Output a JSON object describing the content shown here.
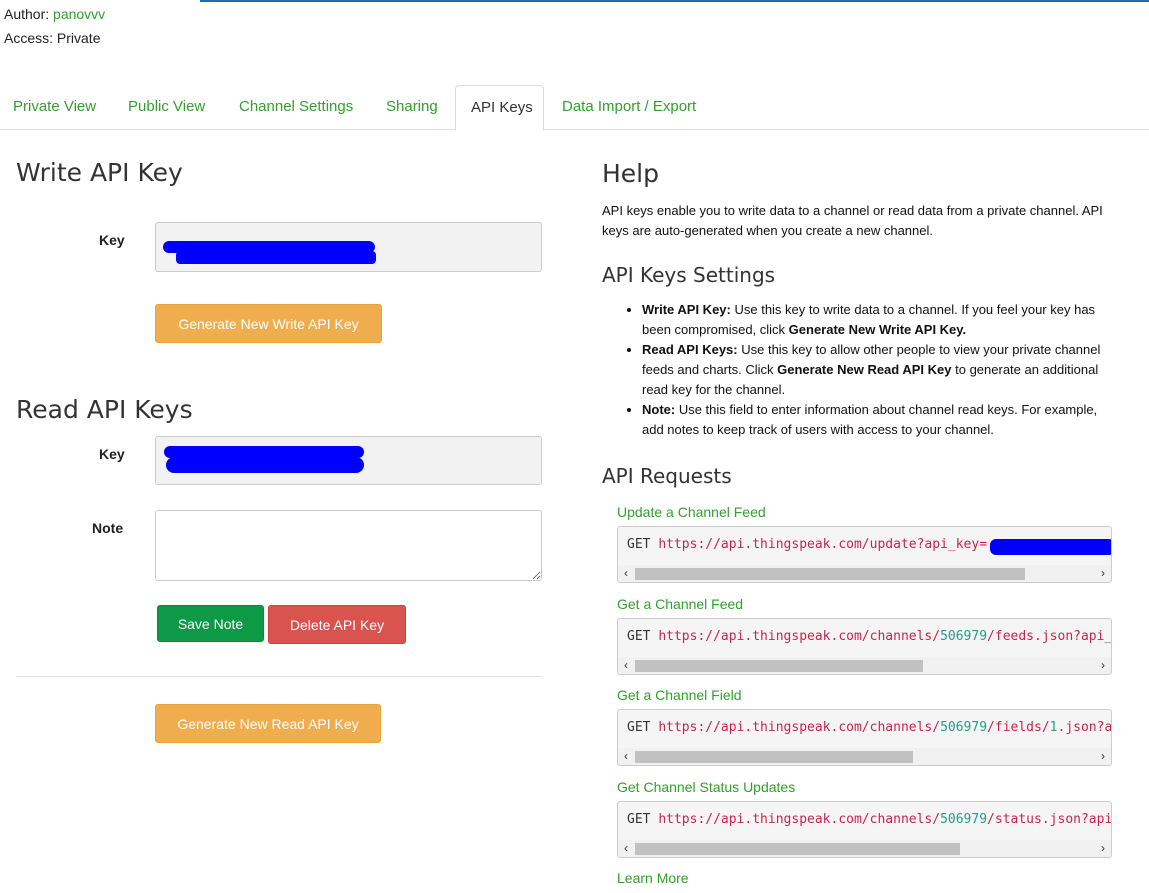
{
  "meta": {
    "author_label": "Author:",
    "author_name": "panovvv",
    "access_label": "Access:",
    "access_value": "Private"
  },
  "tabs": [
    {
      "label": "Private View"
    },
    {
      "label": "Public View"
    },
    {
      "label": "Channel Settings"
    },
    {
      "label": "Sharing"
    },
    {
      "label": "API Keys"
    },
    {
      "label": "Data Import / Export"
    }
  ],
  "write": {
    "title": "Write API Key",
    "key_label": "Key",
    "generate_button": "Generate New Write API Key"
  },
  "read": {
    "title": "Read API Keys",
    "key_label": "Key",
    "note_label": "Note",
    "save_button": "Save Note",
    "delete_button": "Delete API Key",
    "generate_button": "Generate New Read API Key"
  },
  "help": {
    "title": "Help",
    "intro": "API keys enable you to write data to a channel or read data from a private channel. API keys are auto-generated when you create a new channel.",
    "settings_title": "API Keys Settings",
    "bullets": [
      {
        "bold": "Write API Key:",
        "text": " Use this key to write data to a channel. If you feel your key has been compromised, click ",
        "bold2": "Generate New Write API Key.",
        "text2": ""
      },
      {
        "bold": "Read API Keys:",
        "text": " Use this key to allow other people to view your private channel feeds and charts. Click ",
        "bold2": "Generate New Read API Key",
        "text2": " to generate an additional read key for the channel."
      },
      {
        "bold": "Note:",
        "text": " Use this field to enter information about channel read keys. For example, add notes to keep track of users with access to your channel.",
        "bold2": "",
        "text2": ""
      }
    ],
    "requests_title": "API Requests",
    "requests": [
      {
        "title": "Update a Channel Feed",
        "method": "GET",
        "url_a": "https://api.thingspeak.com/update?api_key=",
        "num": "",
        "url_b": "",
        "url_c": "",
        "url_d": ""
      },
      {
        "title": "Get a Channel Feed",
        "method": "GET",
        "url_a": "https://api.thingspeak.com/channels/",
        "num": "506979",
        "url_b": "/feeds.json?api_",
        "url_c": "",
        "url_d": ""
      },
      {
        "title": "Get a Channel Field",
        "method": "GET",
        "url_a": "https://api.thingspeak.com/channels/",
        "num": "506979",
        "url_b": "/fields/",
        "url_c": "1",
        "url_d": ".json?a"
      },
      {
        "title": "Get Channel Status Updates",
        "method": "GET",
        "url_a": "https://api.thingspeak.com/channels/",
        "num": "506979",
        "url_b": "/status.json?api",
        "url_c": "",
        "url_d": ""
      }
    ],
    "learn_more": "Learn More"
  }
}
